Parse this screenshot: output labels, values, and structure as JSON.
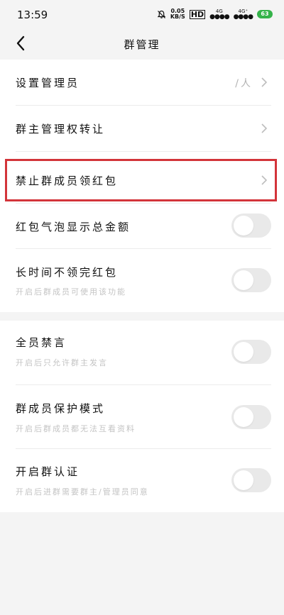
{
  "status_bar": {
    "time": "13:59",
    "speed_value": "0.05",
    "speed_unit": "KB/S",
    "hd_label": "HD",
    "net1": "4G",
    "net2": "4G⁺",
    "battery": "63"
  },
  "header": {
    "title": "群管理"
  },
  "section1": {
    "set_admin_label": "设置管理员",
    "set_admin_value": "/人",
    "transfer_label": "群主管理权转让",
    "forbid_redpacket_label": "禁止群成员领红包",
    "show_amount_label": "红包气泡显示总金额",
    "unclaimed_label": "长时间不领完红包",
    "unclaimed_sub": "开启后群成员可使用该功能"
  },
  "section2": {
    "mute_all_label": "全员禁言",
    "mute_all_sub": "开启后只允许群主发言",
    "protect_label": "群成员保护模式",
    "protect_sub": "开启后群成员都无法互看资料",
    "verify_label": "开启群认证",
    "verify_sub": "开启后进群需要群主/管理员同意"
  },
  "toggles": {
    "show_amount": false,
    "unclaimed": false,
    "mute_all": false,
    "protect": false,
    "verify": false
  },
  "colors": {
    "highlight_border": "#d3343a",
    "toggle_off": "#e9e9e9",
    "battery": "#35b34a"
  }
}
